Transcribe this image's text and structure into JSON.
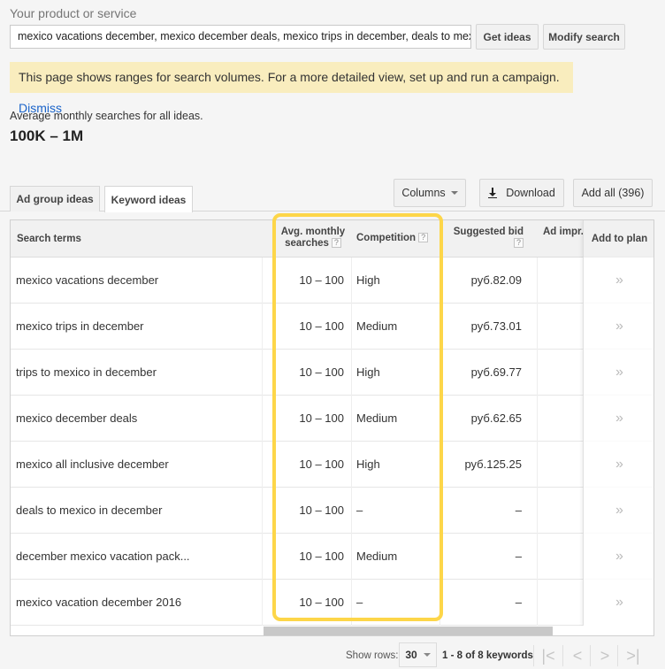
{
  "search": {
    "label": "Your product or service",
    "value": "mexico vacations december, mexico december deals, mexico trips in december, deals to mexico",
    "get_ideas": "Get ideas",
    "modify_search": "Modify search"
  },
  "notice": {
    "text": "This page shows ranges for search volumes. For a more detailed view, set up and run a campaign.",
    "dismiss": "Dismiss"
  },
  "summary": {
    "label": "Average monthly searches for all ideas.",
    "value": "100K – 1M"
  },
  "tabs": [
    {
      "label": "Ad group ideas",
      "active": false
    },
    {
      "label": "Keyword ideas",
      "active": true
    }
  ],
  "toolbar": {
    "columns": "Columns",
    "download": "Download",
    "add_all": "Add all (396)"
  },
  "table": {
    "headers": {
      "search_terms": "Search terms",
      "avg_line1": "Avg. monthly",
      "avg_line2": "searches",
      "competition": "Competition",
      "suggested_bid": "Suggested bid",
      "ad_impr": "Ad impr.",
      "add_to_plan": "Add to plan",
      "help": "?"
    },
    "rows": [
      {
        "term": "mexico vacations december",
        "avg": "10 – 100",
        "competition": "High",
        "bid": "руб.82.09",
        "impr": "",
        "add": "»"
      },
      {
        "term": "mexico trips in december",
        "avg": "10 – 100",
        "competition": "Medium",
        "bid": "руб.73.01",
        "impr": "",
        "add": "»"
      },
      {
        "term": "trips to mexico in december",
        "avg": "10 – 100",
        "competition": "High",
        "bid": "руб.69.77",
        "impr": "",
        "add": "»"
      },
      {
        "term": "mexico december deals",
        "avg": "10 – 100",
        "competition": "Medium",
        "bid": "руб.62.65",
        "impr": "",
        "add": "»"
      },
      {
        "term": "mexico all inclusive december",
        "avg": "10 – 100",
        "competition": "High",
        "bid": "руб.125.25",
        "impr": "",
        "add": "»"
      },
      {
        "term": "deals to mexico in december",
        "avg": "10 – 100",
        "competition": "–",
        "bid": "–",
        "impr": "",
        "add": "»"
      },
      {
        "term": "december mexico vacation pack...",
        "avg": "10 – 100",
        "competition": "Medium",
        "bid": "–",
        "impr": "",
        "add": "»"
      },
      {
        "term": "mexico vacation december 2016",
        "avg": "10 – 100",
        "competition": "–",
        "bid": "–",
        "impr": "",
        "add": "»"
      }
    ]
  },
  "footer": {
    "show_rows_label": "Show rows:",
    "rows_value": "30",
    "range": "1 - 8 of 8 keywords",
    "first": "|<",
    "prev": "<",
    "next": ">",
    "last": ">|"
  },
  "colors": {
    "highlight": "#fdd649",
    "notice_bg": "#f9edbe",
    "link": "#1a63c9"
  }
}
